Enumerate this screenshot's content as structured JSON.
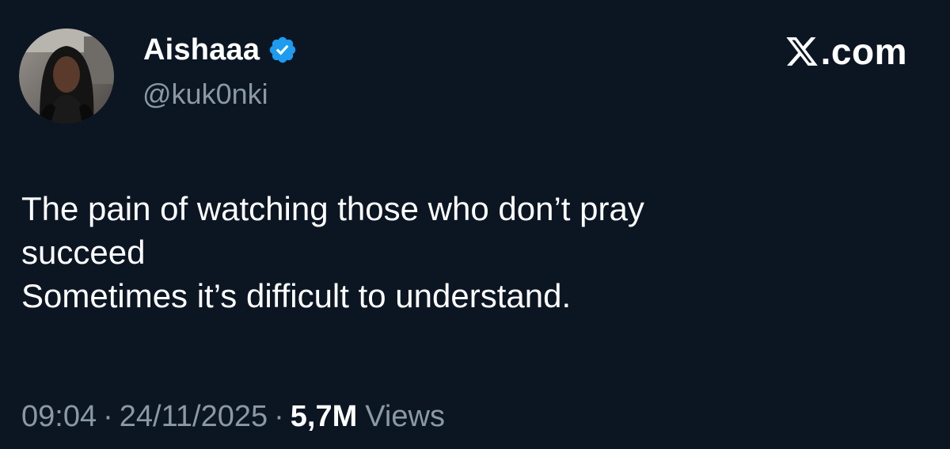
{
  "author": {
    "name": "Aishaaa",
    "handle": "@kuk0nki",
    "verified": true,
    "verified_color": "#1d9bf0"
  },
  "brand": {
    "suffix": ".com",
    "icon": "x-logo-icon"
  },
  "tweet": {
    "lines": [
      "The pain of watching those who don’t pray",
      "succeed",
      "Sometimes it’s difficult to understand."
    ]
  },
  "meta": {
    "time": "09:04",
    "date": "24/11/2025",
    "separator": "·",
    "views_count": "5,7M",
    "views_label": "Views"
  },
  "colors": {
    "background": "#0c1623",
    "primary_text": "#ffffff",
    "secondary_text": "#8b98a5"
  }
}
